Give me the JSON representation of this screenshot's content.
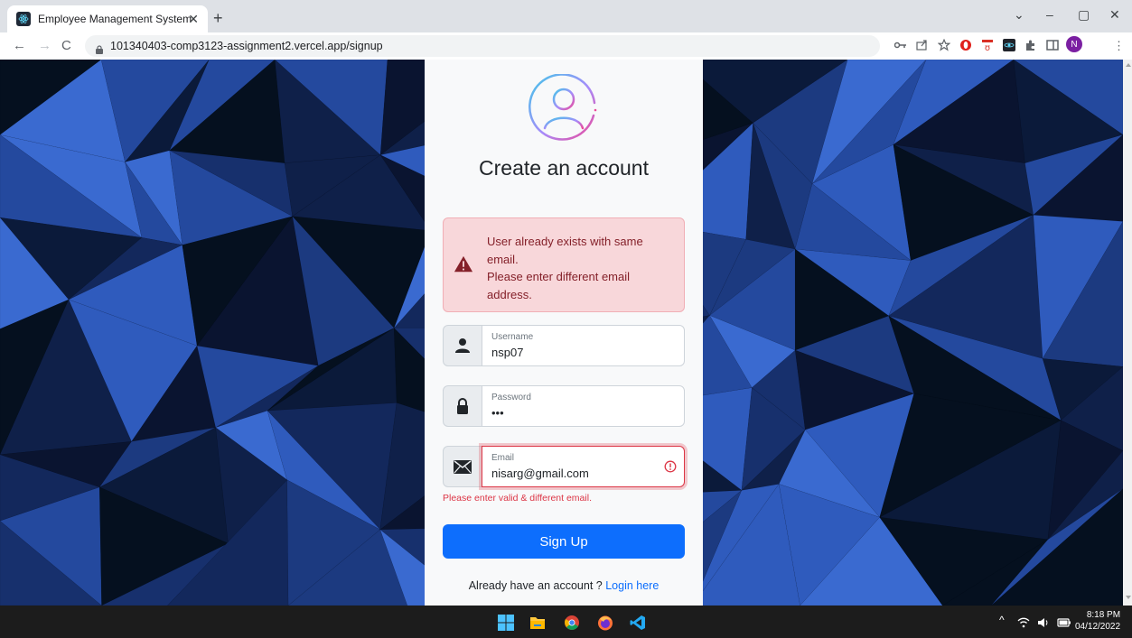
{
  "browser": {
    "tab_title": "Employee Management System",
    "tab_close": "✕",
    "new_tab": "+",
    "url": "101340403-comp3123-assignment2.vercel.app/signup",
    "nav": {
      "back": "←",
      "forward": "→",
      "reload": "C"
    },
    "window_controls": {
      "dropdown": "⌄",
      "minimize": "–",
      "restore": "▢",
      "close": "✕"
    },
    "profile_initial": "N"
  },
  "signup": {
    "heading": "Create an account",
    "alert": {
      "line1": "User already exists with same email.",
      "line2": "Please enter different email address."
    },
    "username": {
      "label": "Username",
      "value": "nsp07"
    },
    "password": {
      "label": "Password",
      "value": "•••"
    },
    "email": {
      "label": "Email",
      "value": "nisarg@gmail.com",
      "feedback": "Please enter valid & different email."
    },
    "submit_label": "Sign Up",
    "login_prompt": "Already have an account ?",
    "login_link": "Login here"
  },
  "taskbar": {
    "time": "8:18 PM",
    "date": "04/12/2022",
    "tray_up_arrow": "^"
  },
  "colors": {
    "primary": "#0d6efd",
    "danger": "#dc3545",
    "alert_bg": "#f8d7da",
    "alert_text": "#842029"
  }
}
